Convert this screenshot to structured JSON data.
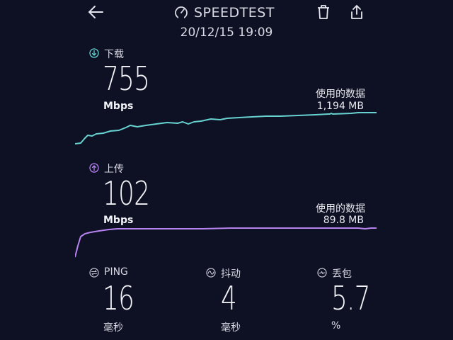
{
  "header": {
    "title": "SPEEDTEST",
    "datetime": "20/12/15 19:09"
  },
  "download": {
    "label": "下载",
    "value": "755",
    "unit": "Mbps",
    "usage_label": "使用的数据",
    "usage_value": "1,194 MB",
    "color": "#67d3d0"
  },
  "upload": {
    "label": "上传",
    "value": "102",
    "unit": "Mbps",
    "usage_label": "使用的数据",
    "usage_value": "89.8 MB",
    "color": "#b783f0"
  },
  "stats": [
    {
      "label": "PING",
      "value": "16",
      "unit": "毫秒",
      "icon": "ping-icon"
    },
    {
      "label": "抖动",
      "value": "4",
      "unit": "毫秒",
      "icon": "jitter-icon"
    },
    {
      "label": "丢包",
      "value": "5.7",
      "unit": "%",
      "icon": "packet-loss-icon"
    }
  ]
}
